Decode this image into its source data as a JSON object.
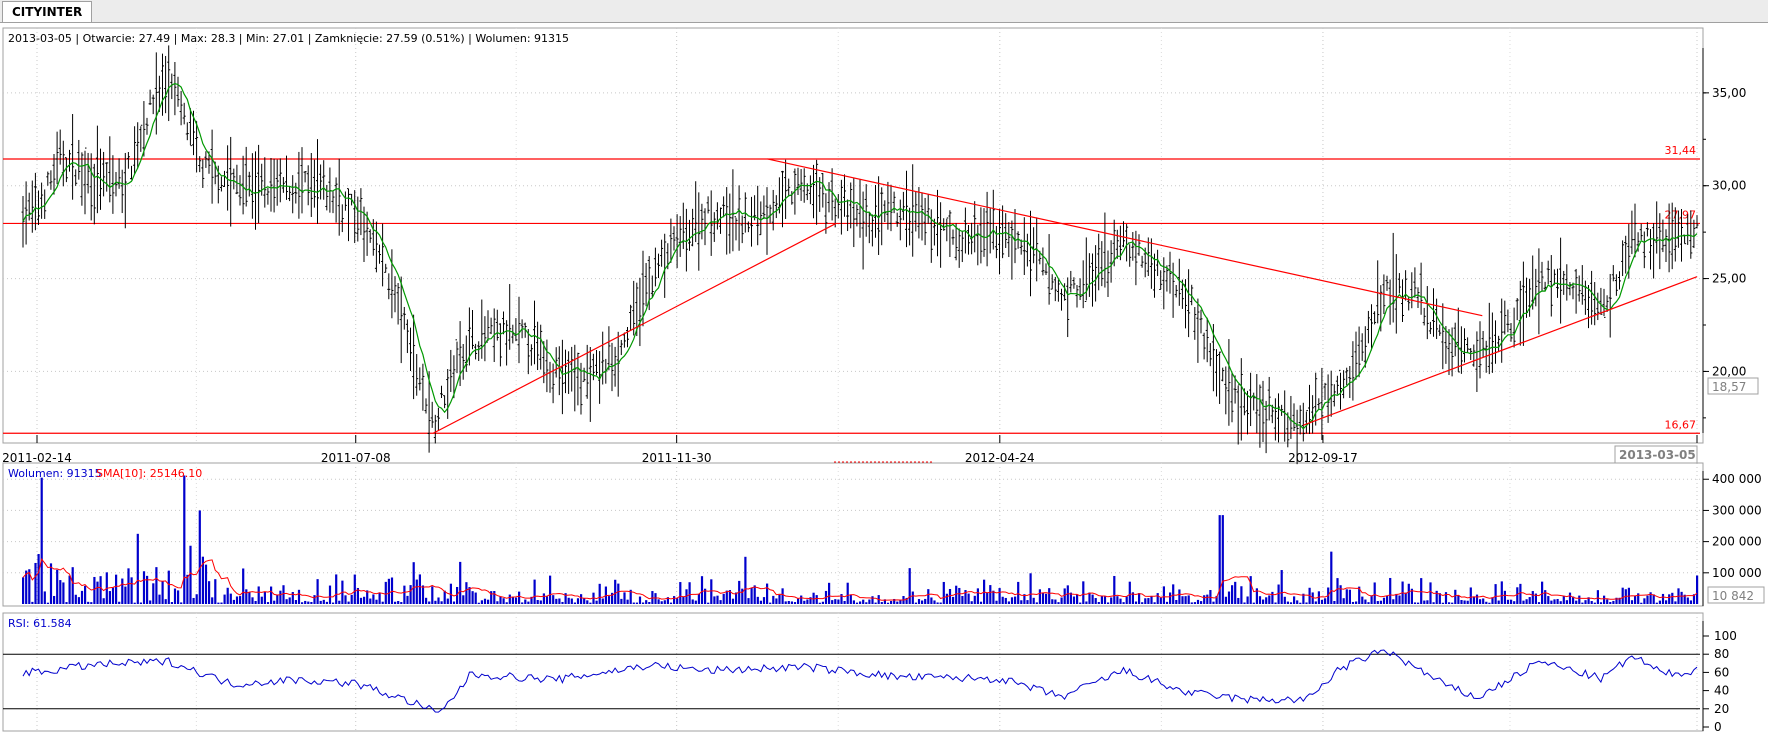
{
  "tab": {
    "label": "CITYINTER"
  },
  "price_panel": {
    "info_text": "2013-03-05 | Otwarcie: 27.49 | Max: 28.3 | Min: 27.01 | Zamknięcie: 27.59 (0.51%)  | Wolumen: 91315",
    "current_value_label": "18,57",
    "date_labels": [
      "2011-02-14",
      "2011-07-08",
      "2011-11-30",
      "2012-04-24",
      "2012-09-17"
    ],
    "last_date_label": "2013-03-05"
  },
  "volume_panel": {
    "label_volume": "Wolumen: 91315",
    "label_sma": "SMA[10]: 25146.10",
    "current_value_label": "10 842"
  },
  "rsi_panel": {
    "label": "RSI: 61.584"
  },
  "chart_data": {
    "type": "line",
    "panels": [
      {
        "name": "price",
        "series_type": "ohlc",
        "y_ticks": [
          "35,00",
          "30,00",
          "25,00",
          "20,00"
        ],
        "ylim": [
          16.2,
          37.2
        ],
        "x_labels": [
          "2011-02-14",
          "2011-07-08",
          "2011-11-30",
          "2012-04-24",
          "2012-09-17",
          "2013-03-05"
        ],
        "horizontal_levels": [
          31.44,
          27.97,
          16.67
        ],
        "horizontal_level_labels": [
          "31,44",
          "27,97",
          "16,67"
        ],
        "trend_lines": [
          {
            "from": [
              "2011-08-12",
              16.67
            ],
            "to": [
              "2012-02-10",
              27.97
            ]
          },
          {
            "from": [
              "2012-01-10",
              31.44
            ],
            "to": [
              "2012-11-28",
              23.0
            ]
          },
          {
            "from": [
              "2012-09-08",
              17.1
            ],
            "to": [
              "2013-03-05",
              25.1
            ]
          }
        ],
        "close_series": [
          [
            "2011-02-14",
            28.6
          ],
          [
            "2011-02-25",
            31.5
          ],
          [
            "2011-03-10",
            30.5
          ],
          [
            "2011-03-25",
            30.0
          ],
          [
            "2011-04-08",
            34.8
          ],
          [
            "2011-04-15",
            35.8
          ],
          [
            "2011-04-29",
            31.0
          ],
          [
            "2011-05-13",
            30.2
          ],
          [
            "2011-05-27",
            29.8
          ],
          [
            "2011-06-10",
            30.0
          ],
          [
            "2011-06-24",
            29.8
          ],
          [
            "2011-07-08",
            28.5
          ],
          [
            "2011-07-22",
            25.5
          ],
          [
            "2011-08-05",
            20.0
          ],
          [
            "2011-08-12",
            17.2
          ],
          [
            "2011-08-26",
            21.5
          ],
          [
            "2011-09-09",
            22.0
          ],
          [
            "2011-09-23",
            21.8
          ],
          [
            "2011-10-07",
            20.0
          ],
          [
            "2011-10-21",
            19.5
          ],
          [
            "2011-11-04",
            21.0
          ],
          [
            "2011-11-18",
            25.0
          ],
          [
            "2011-11-30",
            27.0
          ],
          [
            "2011-12-14",
            28.5
          ],
          [
            "2011-12-30",
            28.0
          ],
          [
            "2012-01-13",
            29.0
          ],
          [
            "2012-01-27",
            30.0
          ],
          [
            "2012-02-10",
            29.0
          ],
          [
            "2012-02-24",
            28.0
          ],
          [
            "2012-03-09",
            28.5
          ],
          [
            "2012-03-23",
            28.0
          ],
          [
            "2012-04-06",
            27.0
          ],
          [
            "2012-04-24",
            27.5
          ],
          [
            "2012-05-08",
            26.5
          ],
          [
            "2012-05-22",
            24.0
          ],
          [
            "2012-06-05",
            25.0
          ],
          [
            "2012-06-19",
            27.0
          ],
          [
            "2012-07-03",
            25.5
          ],
          [
            "2012-07-17",
            24.5
          ],
          [
            "2012-07-31",
            20.0
          ],
          [
            "2012-08-14",
            18.0
          ],
          [
            "2012-08-28",
            17.5
          ],
          [
            "2012-09-10",
            17.2
          ],
          [
            "2012-09-17",
            19.0
          ],
          [
            "2012-10-01",
            20.0
          ],
          [
            "2012-10-15",
            24.5
          ],
          [
            "2012-10-29",
            24.0
          ],
          [
            "2012-11-12",
            21.5
          ],
          [
            "2012-11-26",
            21.0
          ],
          [
            "2012-12-10",
            22.5
          ],
          [
            "2012-12-24",
            25.0
          ],
          [
            "2013-01-07",
            24.5
          ],
          [
            "2013-01-21",
            23.5
          ],
          [
            "2013-02-04",
            27.0
          ],
          [
            "2013-02-18",
            27.3
          ],
          [
            "2013-03-05",
            27.59
          ]
        ]
      },
      {
        "name": "volume",
        "series_type": "bar",
        "y_ticks": [
          "400 000",
          "300 000",
          "200 000",
          "100 000"
        ],
        "ylim": [
          0,
          420000
        ],
        "series": [
          {
            "name": "Wolumen",
            "color": "#0000cc"
          },
          {
            "name": "SMA[10]",
            "color": "#ff0000"
          }
        ],
        "volume_peaks": [
          [
            "2011-02-16",
            405000
          ],
          [
            "2011-04-01",
            225000
          ],
          [
            "2011-04-21",
            412000
          ],
          [
            "2011-04-29",
            300000
          ],
          [
            "2011-08-24",
            135000
          ],
          [
            "2012-08-02",
            285000
          ],
          [
            "2013-03-05",
            91315
          ]
        ]
      },
      {
        "name": "rsi",
        "series_type": "line",
        "y_ticks": [
          "100",
          "80",
          "60",
          "40",
          "20",
          "0"
        ],
        "ylim": [
          0,
          100
        ],
        "levels": [
          80,
          20
        ],
        "series": [
          {
            "name": "RSI",
            "color": "#0000cc"
          }
        ],
        "points": [
          [
            "2011-02-14",
            60
          ],
          [
            "2011-03-10",
            68
          ],
          [
            "2011-04-15",
            72
          ],
          [
            "2011-05-13",
            47
          ],
          [
            "2011-06-10",
            52
          ],
          [
            "2011-07-08",
            48
          ],
          [
            "2011-08-05",
            25
          ],
          [
            "2011-08-15",
            14
          ],
          [
            "2011-08-29",
            58
          ],
          [
            "2011-10-07",
            52
          ],
          [
            "2011-11-18",
            68
          ],
          [
            "2011-12-14",
            62
          ],
          [
            "2012-01-27",
            66
          ],
          [
            "2012-03-09",
            55
          ],
          [
            "2012-04-24",
            53
          ],
          [
            "2012-05-22",
            33
          ],
          [
            "2012-06-19",
            62
          ],
          [
            "2012-07-17",
            38
          ],
          [
            "2012-08-14",
            30
          ],
          [
            "2012-09-10",
            30
          ],
          [
            "2012-09-24",
            63
          ],
          [
            "2012-10-15",
            85
          ],
          [
            "2012-11-12",
            45
          ],
          [
            "2012-11-26",
            32
          ],
          [
            "2012-12-24",
            72
          ],
          [
            "2013-01-21",
            53
          ],
          [
            "2013-02-04",
            78
          ],
          [
            "2013-02-18",
            58
          ],
          [
            "2013-03-05",
            61.584
          ]
        ]
      }
    ]
  }
}
